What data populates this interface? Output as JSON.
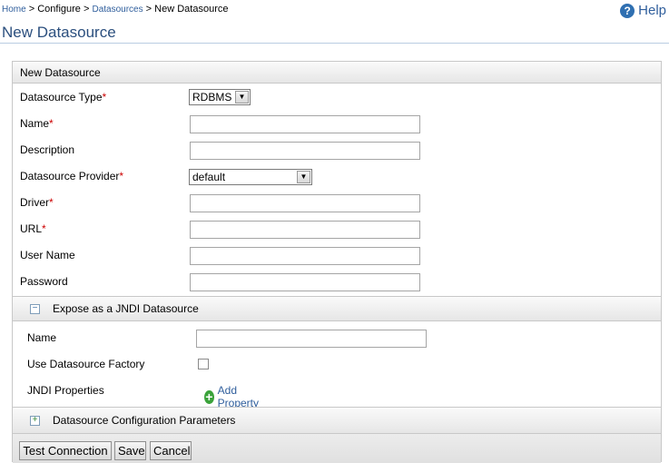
{
  "breadcrumb": {
    "home": "Home",
    "sep1": " > ",
    "configure": "Configure",
    "sep2": " > ",
    "datasources": "Datasources",
    "sep3": " > ",
    "current": "New Datasource"
  },
  "help": {
    "label": "Help"
  },
  "page_title": "New Datasource",
  "form": {
    "section_title": "New Datasource",
    "fields": {
      "datasource_type": {
        "label": "Datasource Type",
        "required": "*",
        "value": "RDBMS"
      },
      "name": {
        "label": "Name",
        "required": "*",
        "value": ""
      },
      "description": {
        "label": "Description",
        "value": ""
      },
      "provider": {
        "label": "Datasource Provider",
        "required": "*",
        "value": "default"
      },
      "driver": {
        "label": "Driver",
        "required": "*",
        "value": ""
      },
      "url": {
        "label": "URL",
        "required": "*",
        "value": ""
      },
      "username": {
        "label": "User Name",
        "value": ""
      },
      "password": {
        "label": "Password",
        "value": ""
      }
    }
  },
  "jndi": {
    "title": "Expose as a JNDI Datasource",
    "toggle": "−",
    "name_label": "Name",
    "name_value": "",
    "factory_label": "Use Datasource Factory",
    "factory_checked": false,
    "properties_label": "JNDI Properties",
    "add_property": "Add Property"
  },
  "config_params": {
    "title": "Datasource Configuration Parameters",
    "toggle": "+"
  },
  "buttons": {
    "test_connection": "Test Connection",
    "save": "Save",
    "cancel": "Cancel"
  },
  "colors": {
    "link": "#2f5e9c",
    "title": "#2b4f7e",
    "required": "#cc0000",
    "add_icon": "#3aa23a"
  }
}
